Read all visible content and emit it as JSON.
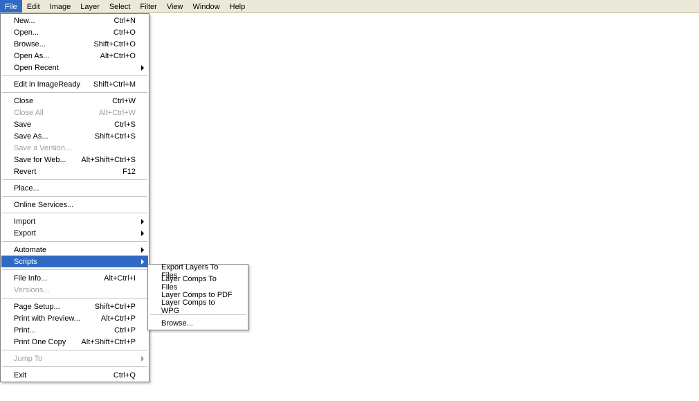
{
  "menubar": {
    "items": [
      {
        "label": "File",
        "active": true
      },
      {
        "label": "Edit"
      },
      {
        "label": "Image"
      },
      {
        "label": "Layer"
      },
      {
        "label": "Select"
      },
      {
        "label": "Filter"
      },
      {
        "label": "View"
      },
      {
        "label": "Window"
      },
      {
        "label": "Help"
      }
    ]
  },
  "file_menu": {
    "groups": [
      [
        {
          "label": "New...",
          "shortcut": "Ctrl+N"
        },
        {
          "label": "Open...",
          "shortcut": "Ctrl+O"
        },
        {
          "label": "Browse...",
          "shortcut": "Shift+Ctrl+O"
        },
        {
          "label": "Open As...",
          "shortcut": "Alt+Ctrl+O"
        },
        {
          "label": "Open Recent",
          "submenu": true
        }
      ],
      [
        {
          "label": "Edit in ImageReady",
          "shortcut": "Shift+Ctrl+M"
        }
      ],
      [
        {
          "label": "Close",
          "shortcut": "Ctrl+W"
        },
        {
          "label": "Close All",
          "shortcut": "Alt+Ctrl+W",
          "disabled": true
        },
        {
          "label": "Save",
          "shortcut": "Ctrl+S"
        },
        {
          "label": "Save As...",
          "shortcut": "Shift+Ctrl+S"
        },
        {
          "label": "Save a Version...",
          "disabled": true
        },
        {
          "label": "Save for Web...",
          "shortcut": "Alt+Shift+Ctrl+S"
        },
        {
          "label": "Revert",
          "shortcut": "F12"
        }
      ],
      [
        {
          "label": "Place..."
        }
      ],
      [
        {
          "label": "Online Services..."
        }
      ],
      [
        {
          "label": "Import",
          "submenu": true
        },
        {
          "label": "Export",
          "submenu": true
        }
      ],
      [
        {
          "label": "Automate",
          "submenu": true
        },
        {
          "label": "Scripts",
          "submenu": true,
          "highlight": true
        }
      ],
      [
        {
          "label": "File Info...",
          "shortcut": "Alt+Ctrl+I"
        },
        {
          "label": "Versions...",
          "disabled": true
        }
      ],
      [
        {
          "label": "Page Setup...",
          "shortcut": "Shift+Ctrl+P"
        },
        {
          "label": "Print with Preview...",
          "shortcut": "Alt+Ctrl+P"
        },
        {
          "label": "Print...",
          "shortcut": "Ctrl+P"
        },
        {
          "label": "Print One Copy",
          "shortcut": "Alt+Shift+Ctrl+P"
        }
      ],
      [
        {
          "label": "Jump To",
          "submenu": true,
          "disabled": true
        }
      ],
      [
        {
          "label": "Exit",
          "shortcut": "Ctrl+Q"
        }
      ]
    ]
  },
  "scripts_submenu": {
    "groups": [
      [
        {
          "label": "Export Layers To Files"
        },
        {
          "label": "Layer Comps To Files"
        },
        {
          "label": "Layer Comps to PDF"
        },
        {
          "label": "Layer Comps to WPG"
        }
      ],
      [
        {
          "label": "Browse..."
        }
      ]
    ]
  }
}
